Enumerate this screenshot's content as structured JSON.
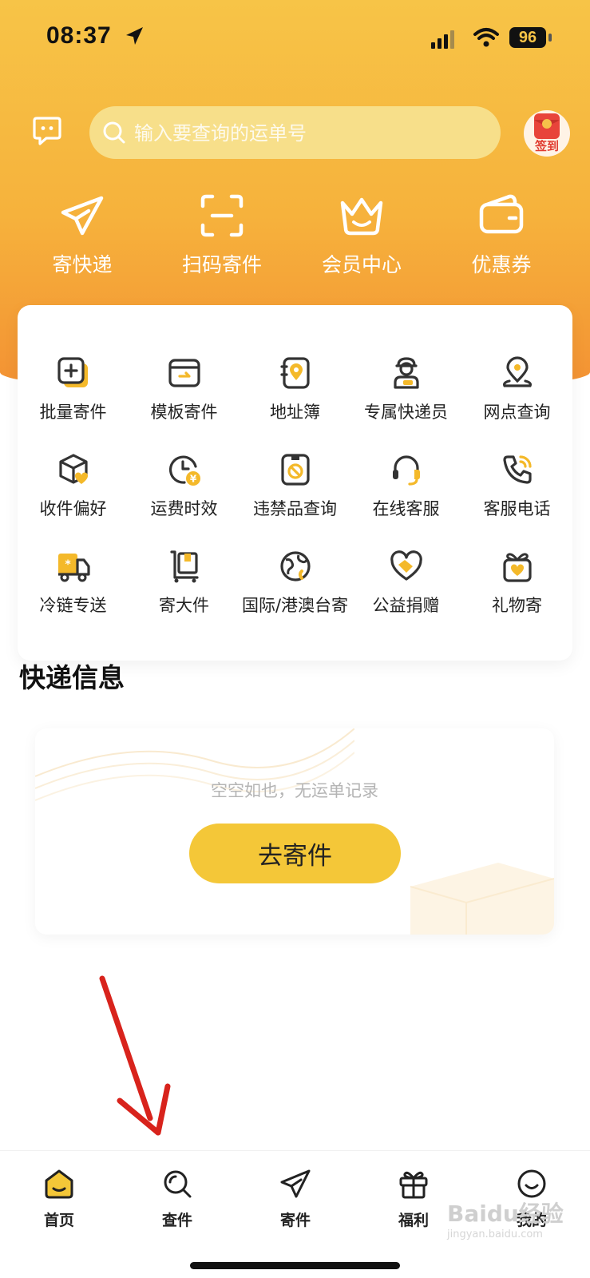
{
  "status": {
    "time": "08:37",
    "battery": "96"
  },
  "search": {
    "placeholder": "输入要查询的运单号"
  },
  "sign_in": {
    "label": "签到"
  },
  "quick_actions": [
    {
      "label": "寄快递",
      "icon": "paper-plane-icon"
    },
    {
      "label": "扫码寄件",
      "icon": "scan-icon"
    },
    {
      "label": "会员中心",
      "icon": "crown-icon"
    },
    {
      "label": "优惠券",
      "icon": "wallet-icon"
    }
  ],
  "services": [
    {
      "label": "批量寄件",
      "icon": "batch-send-icon"
    },
    {
      "label": "模板寄件",
      "icon": "template-icon"
    },
    {
      "label": "地址簿",
      "icon": "address-book-icon"
    },
    {
      "label": "专属快递员",
      "icon": "courier-icon"
    },
    {
      "label": "网点查询",
      "icon": "location-icon"
    },
    {
      "label": "收件偏好",
      "icon": "package-heart-icon"
    },
    {
      "label": "运费时效",
      "icon": "clock-yen-icon"
    },
    {
      "label": "违禁品查询",
      "icon": "prohibited-icon"
    },
    {
      "label": "在线客服",
      "icon": "headset-icon"
    },
    {
      "label": "客服电话",
      "icon": "phone-icon"
    },
    {
      "label": "冷链专送",
      "icon": "cold-truck-icon"
    },
    {
      "label": "寄大件",
      "icon": "cart-box-icon"
    },
    {
      "label": "国际/港澳台寄",
      "icon": "globe-icon"
    },
    {
      "label": "公益捐赠",
      "icon": "charity-heart-icon"
    },
    {
      "label": "礼物寄",
      "icon": "gift-icon"
    }
  ],
  "express_info": {
    "title": "快递信息",
    "empty_text": "空空如也，无运单记录",
    "button_label": "去寄件"
  },
  "tabs": [
    {
      "label": "首页",
      "icon": "home-icon"
    },
    {
      "label": "查件",
      "icon": "search-icon"
    },
    {
      "label": "寄件",
      "icon": "send-icon"
    },
    {
      "label": "福利",
      "icon": "gift-icon"
    },
    {
      "label": "我的",
      "icon": "smile-icon"
    }
  ],
  "watermark": {
    "brand": "Baidu经验",
    "url": "jingyan.baidu.com"
  },
  "colors": {
    "brand_yellow": "#f4c738",
    "icon_accent": "#f4b92a",
    "icon_dark": "#333333"
  }
}
